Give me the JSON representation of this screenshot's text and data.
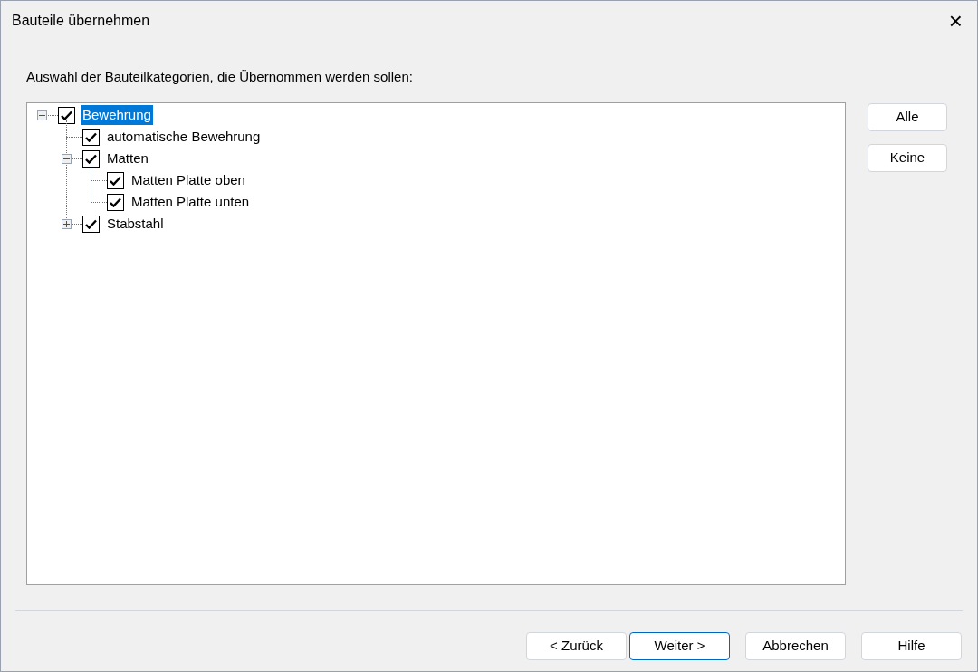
{
  "window": {
    "title": "Bauteile übernehmen",
    "close": "×"
  },
  "instruction": "Auswahl der Bauteilkategorien, die Übernommen werden sollen:",
  "tree": [
    {
      "label": "Bewehrung",
      "checked": true,
      "selected": true,
      "expanded": true,
      "children": [
        {
          "label": "automatische Bewehrung",
          "checked": true,
          "selected": false
        },
        {
          "label": "Matten",
          "checked": true,
          "selected": false,
          "expanded": true,
          "children": [
            {
              "label": "Matten Platte oben",
              "checked": true,
              "selected": false
            },
            {
              "label": "Matten Platte unten",
              "checked": true,
              "selected": false
            }
          ]
        },
        {
          "label": "Stabstahl",
          "checked": true,
          "selected": false,
          "expanded": false
        }
      ]
    }
  ],
  "side_buttons": [
    "Alle",
    "Keine"
  ],
  "footer_buttons": [
    {
      "label": "< Zurück",
      "default": false
    },
    {
      "label": "Weiter >",
      "default": true
    },
    {
      "label": "Abbrechen",
      "default": false
    },
    {
      "label": "Hilfe",
      "default": false
    }
  ]
}
